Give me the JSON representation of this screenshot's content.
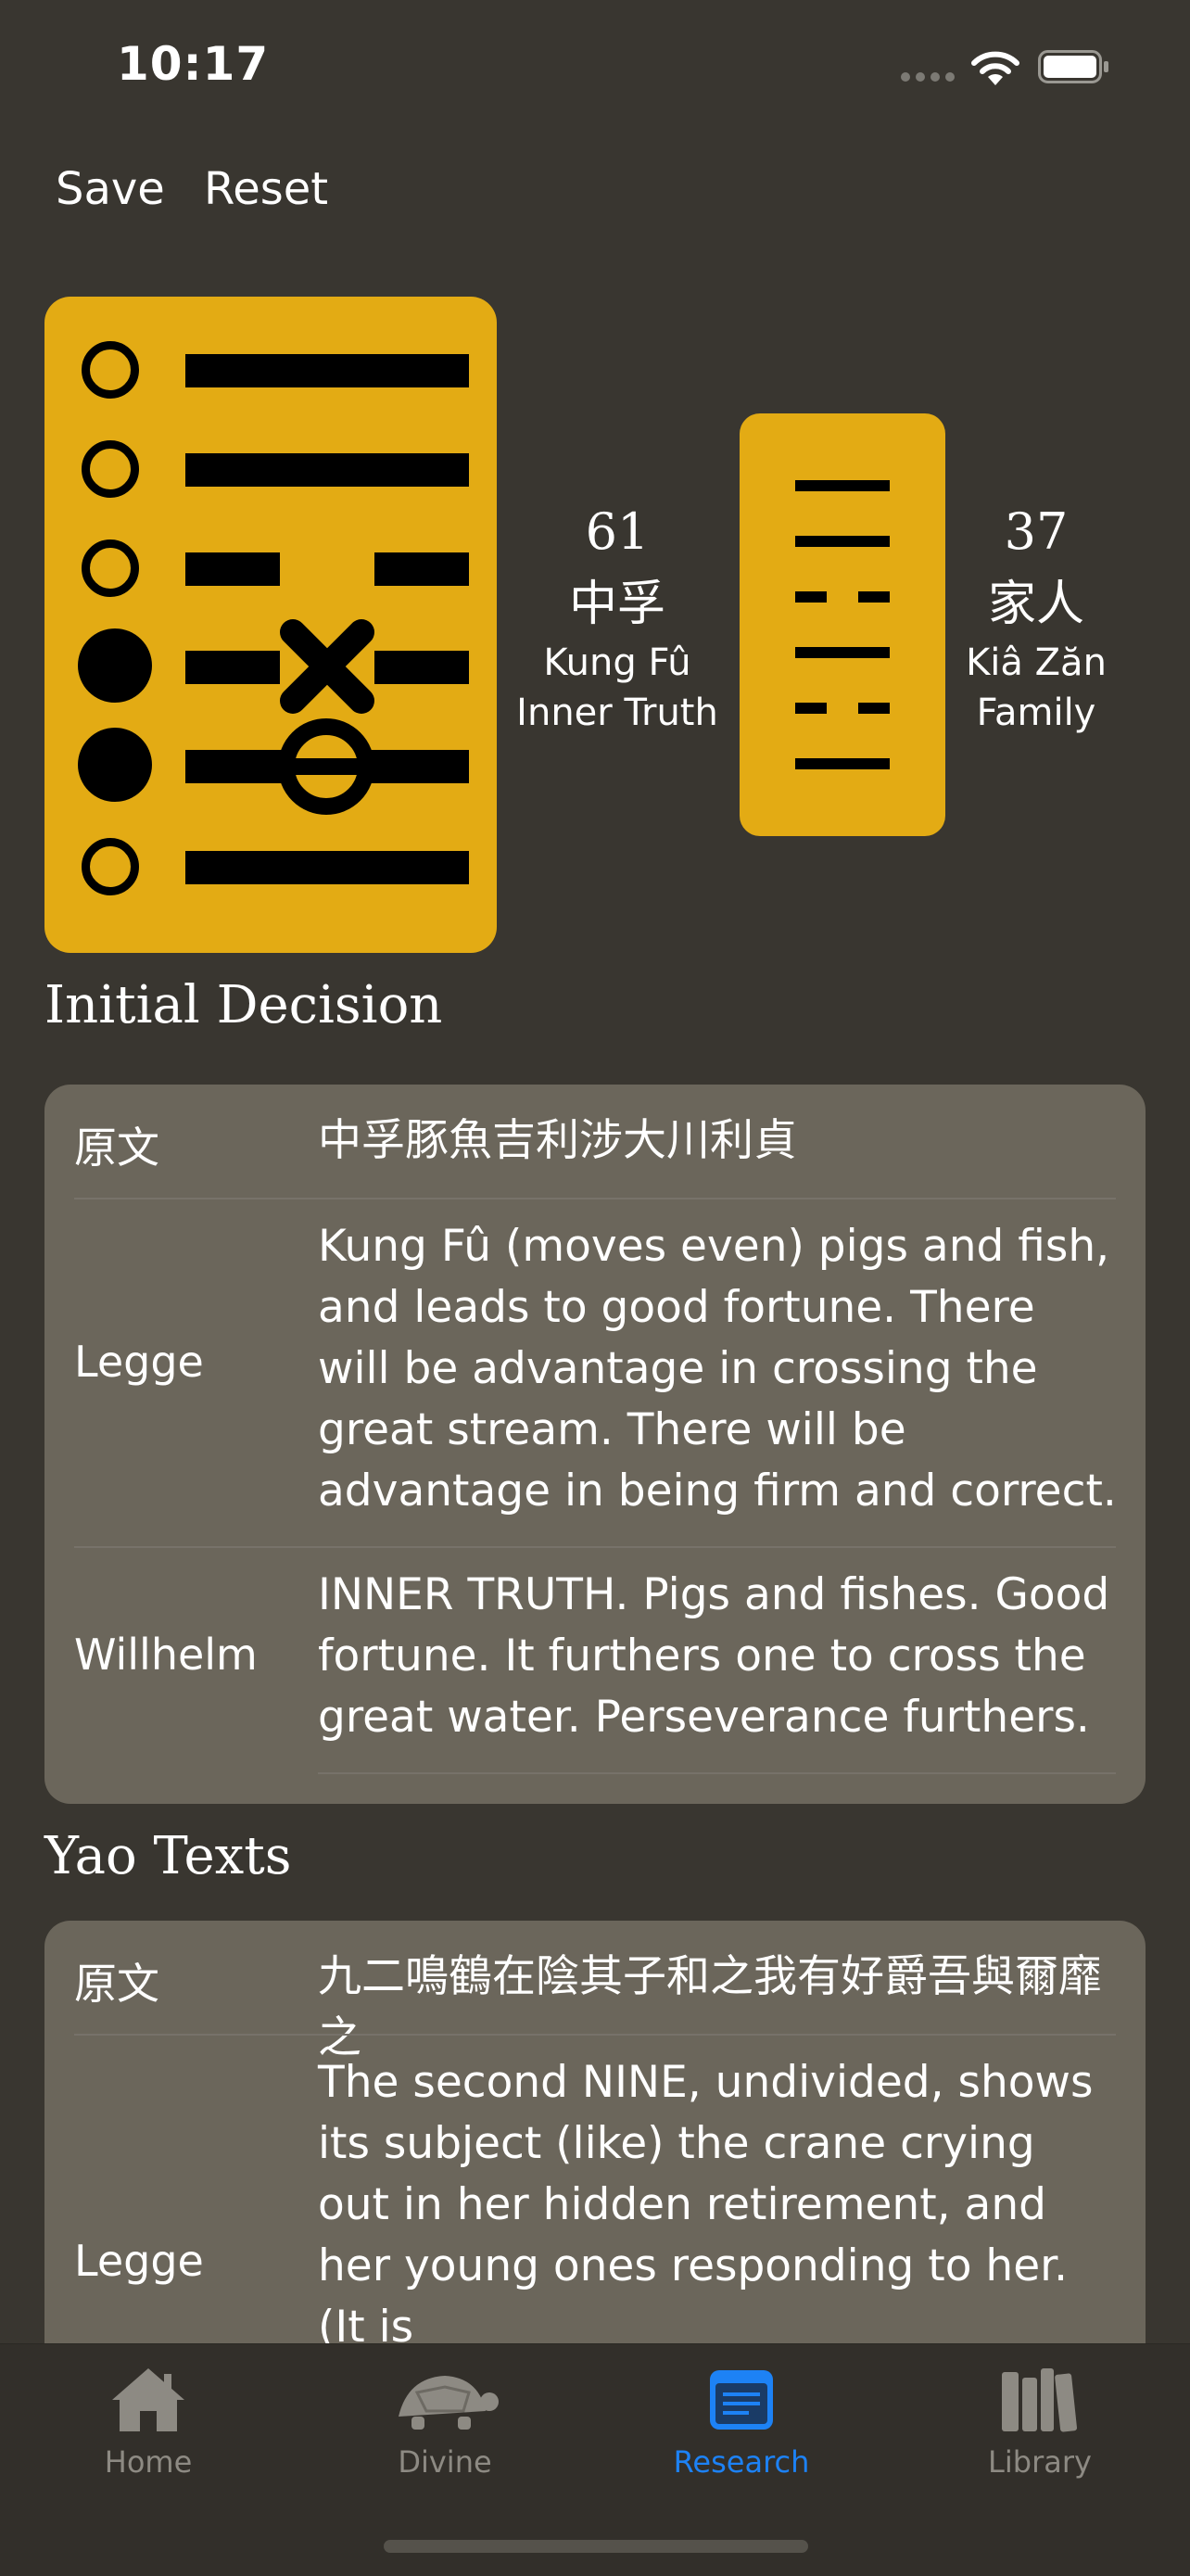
{
  "status_bar": {
    "time": "10:17"
  },
  "nav": {
    "save_label": "Save",
    "reset_label": "Reset"
  },
  "primary_hexagram": {
    "number": "61",
    "chinese": "中孚",
    "pinyin": "Kung Fû",
    "english": "Inner Truth"
  },
  "secondary_hexagram": {
    "number": "37",
    "chinese": "家人",
    "pinyin": "Kiâ Zăn",
    "english": "Family"
  },
  "initial_decision": {
    "title": "Initial Decision",
    "rows": [
      {
        "label": "原文",
        "text": "中孚豚魚吉利涉大川利貞"
      },
      {
        "label": "Legge",
        "text": "Kung Fû (moves even) pigs and fish, and leads to good fortune. There will be advantage in crossing the great stream. There will be advantage in being firm and correct."
      },
      {
        "label": "Willhelm",
        "text": "INNER TRUTH. Pigs and fishes. Good fortune. It furthers one to cross the great water. Perseverance furthers."
      }
    ]
  },
  "yao_texts": {
    "title": "Yao Texts",
    "rows": [
      {
        "label": "原文",
        "text": "九二鳴鶴在陰其子和之我有好爵吾與爾靡之"
      },
      {
        "label": "Legge",
        "text": "The second NINE, undivided, shows its subject (like) the crane crying out in her hidden retirement, and her young ones responding to her. (It is"
      }
    ]
  },
  "tabs": [
    {
      "label": "Home",
      "icon": "house-icon"
    },
    {
      "label": "Divine",
      "icon": "turtle-icon"
    },
    {
      "label": "Research",
      "icon": "document-icon"
    },
    {
      "label": "Library",
      "icon": "books-icon"
    }
  ],
  "colors": {
    "background": "#393630",
    "card_gold": "#e3ab14",
    "table_bg": "#6b665b",
    "accent": "#1d82f5",
    "tab_inactive": "#8d8a83"
  }
}
